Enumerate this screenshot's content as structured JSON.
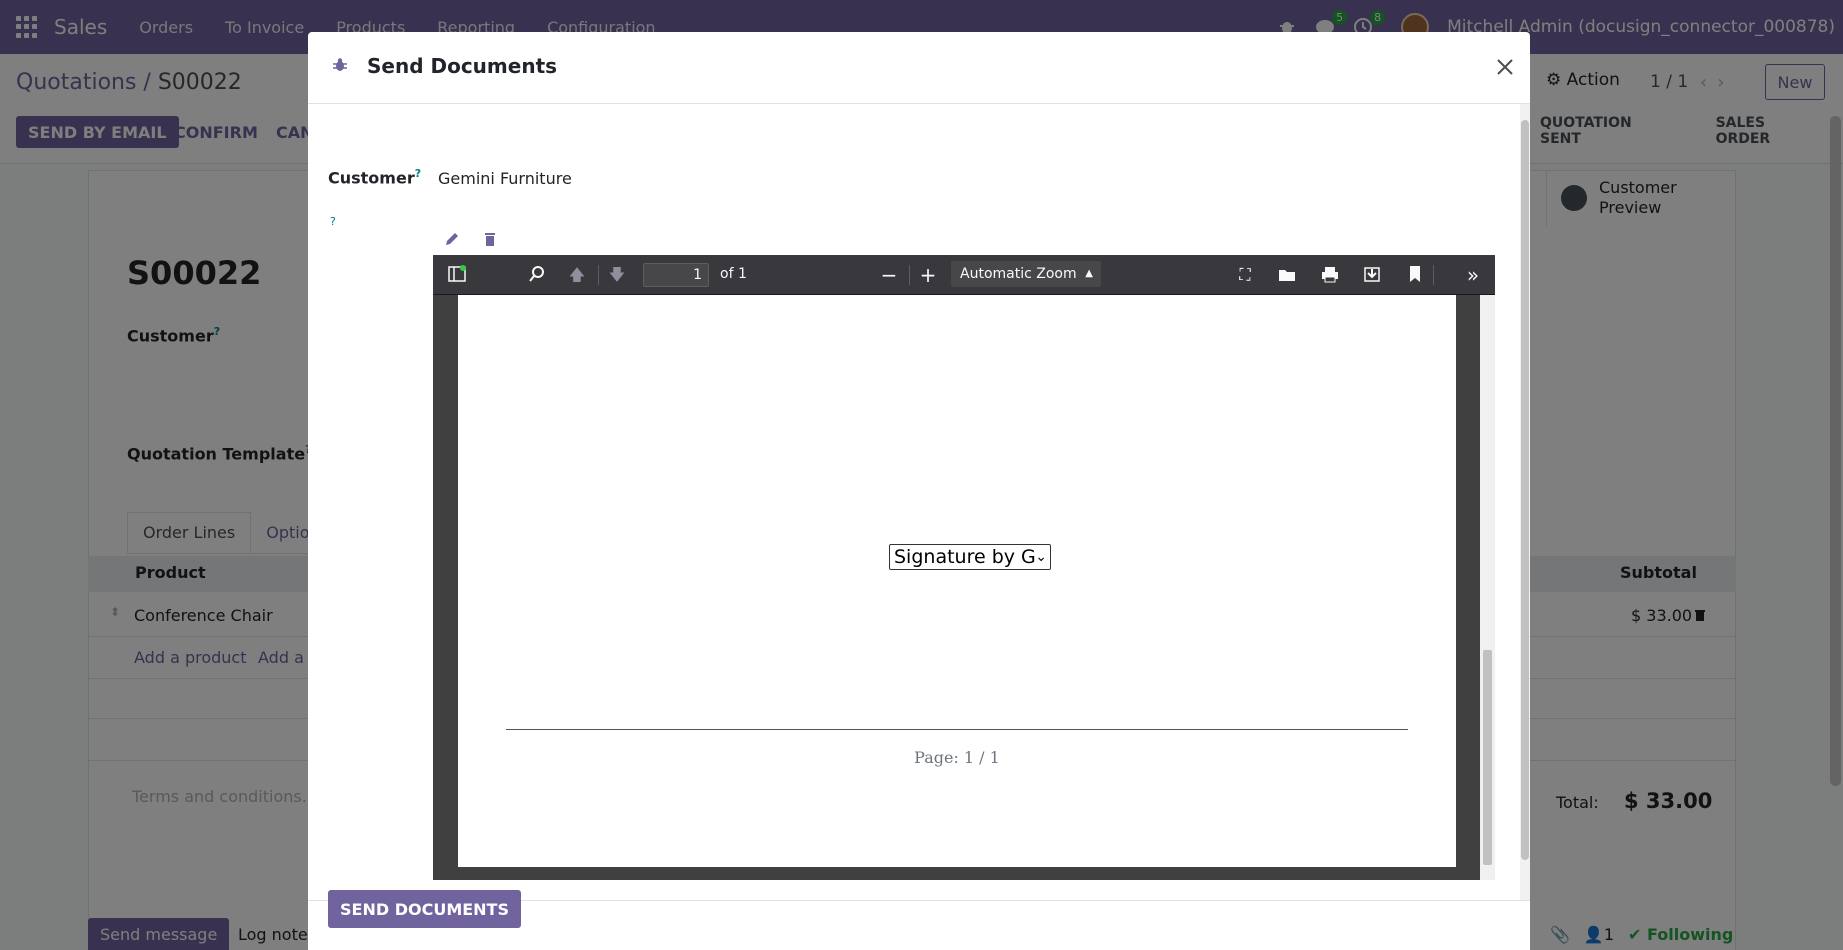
{
  "navbar": {
    "app": "Sales",
    "menu": [
      "Orders",
      "To Invoice",
      "Products",
      "Reporting",
      "Configuration"
    ],
    "chat_count": "5",
    "activity_count": "8",
    "user": "Mitchell Admin (docusign_connector_000878)"
  },
  "control": {
    "breadcrumb_parent": "Quotations",
    "breadcrumb_sep": " / ",
    "breadcrumb_current": "S00022",
    "send_email": "SEND BY EMAIL",
    "confirm": "CONFIRM",
    "cancel": "CAN",
    "action": "Action",
    "pager": "1 / 1",
    "new": "New",
    "status_sent": "QUOTATION SENT",
    "status_order": "SALES ORDER"
  },
  "form": {
    "name": "S00022",
    "customer_label": "Customer",
    "template_label": "Quotation Template",
    "preview_label": "Customer Preview",
    "tab_order_lines": "Order Lines",
    "tab_optional": "Option",
    "col_product": "Product",
    "col_subtotal": "Subtotal",
    "row_product": "Conference Chair",
    "row_subtotal": "$ 33.00",
    "add_product": "Add a product",
    "add_section": "Add a s",
    "terms_placeholder": "Terms and conditions...",
    "total_label": "Total:",
    "total_value": "$ 33.00"
  },
  "chatter": {
    "send_message": "Send message",
    "log_note": "Log note",
    "followers": "1",
    "following": "Following"
  },
  "modal": {
    "title": "Send Documents",
    "customer_label": "Customer",
    "customer_value": "Gemini Furniture",
    "help_mark": "?",
    "submit": "SEND DOCUMENTS"
  },
  "pdf": {
    "page_number": "1",
    "page_of": "of 1",
    "zoom": "Automatic Zoom",
    "signature_field": "Signature by G",
    "page_footer": "Page: 1 / 1"
  },
  "colors": {
    "brand": "#71639e",
    "success": "#28a745"
  }
}
